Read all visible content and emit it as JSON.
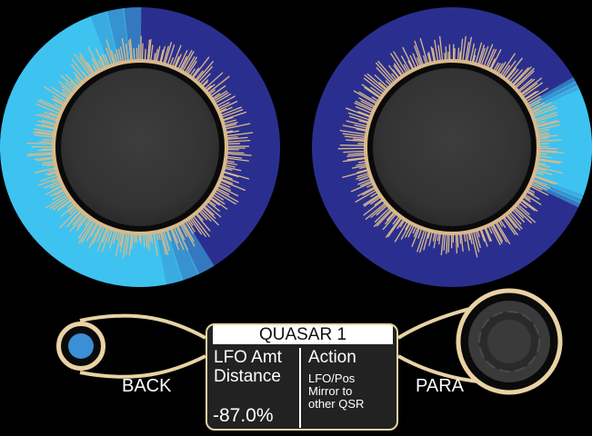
{
  "knobs": [
    {
      "name": "left-knob",
      "value_fraction": 0.55
    },
    {
      "name": "right-knob",
      "value_fraction": 0.2
    }
  ],
  "colors": {
    "ring_active": "#3ec3f0",
    "ring_inactive": "#2a2f8f",
    "fringe": "#d9b98a",
    "knob_cap": "#3a3a3a",
    "panel_outline": "#e9d2a4",
    "back_led": "#3a8fd6"
  },
  "display": {
    "title": "QUASAR 1",
    "param_line1": "LFO Amt",
    "param_line2": "Distance",
    "value": "-87.0%",
    "action_label": "Action",
    "action_desc_1": "LFO/Pos",
    "action_desc_2": "Mirror to",
    "action_desc_3": "other QSR"
  },
  "buttons": {
    "back_label": "BACK",
    "para_label": "PARA"
  }
}
